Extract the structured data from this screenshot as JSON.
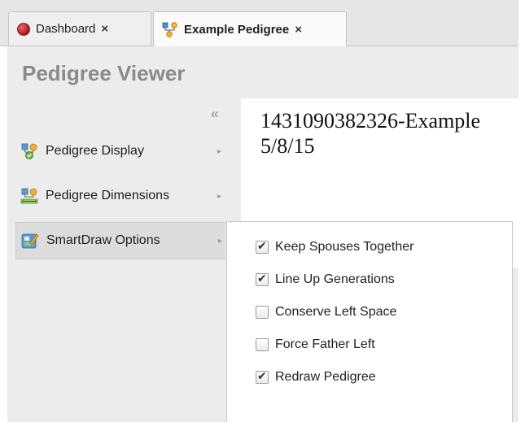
{
  "tabs": [
    {
      "label": "Dashboard",
      "close": "×",
      "icon": "red-circle-icon",
      "active": false
    },
    {
      "label": "Example Pedigree",
      "close": "×",
      "icon": "pedigree-icon",
      "active": true
    }
  ],
  "page": {
    "title": "Pedigree Viewer",
    "collapse_glyph": "«"
  },
  "sidebar": {
    "items": [
      {
        "label": "Pedigree Display",
        "icon": "pedigree-display-icon",
        "arrow": "▸"
      },
      {
        "label": "Pedigree Dimensions",
        "icon": "pedigree-dimensions-icon",
        "arrow": "▸"
      },
      {
        "label": "SmartDraw Options",
        "icon": "smartdraw-icon",
        "arrow": "▸",
        "selected": true
      }
    ]
  },
  "content": {
    "title_line1": "1431090382326-Example",
    "title_line2": "5/8/15"
  },
  "options": [
    {
      "label": "Keep Spouses Together",
      "checked": true
    },
    {
      "label": "Line Up Generations",
      "checked": true
    },
    {
      "label": "Conserve Left Space",
      "checked": false
    },
    {
      "label": "Force Father Left",
      "checked": false
    },
    {
      "label": "Redraw Pedigree",
      "checked": true
    }
  ]
}
